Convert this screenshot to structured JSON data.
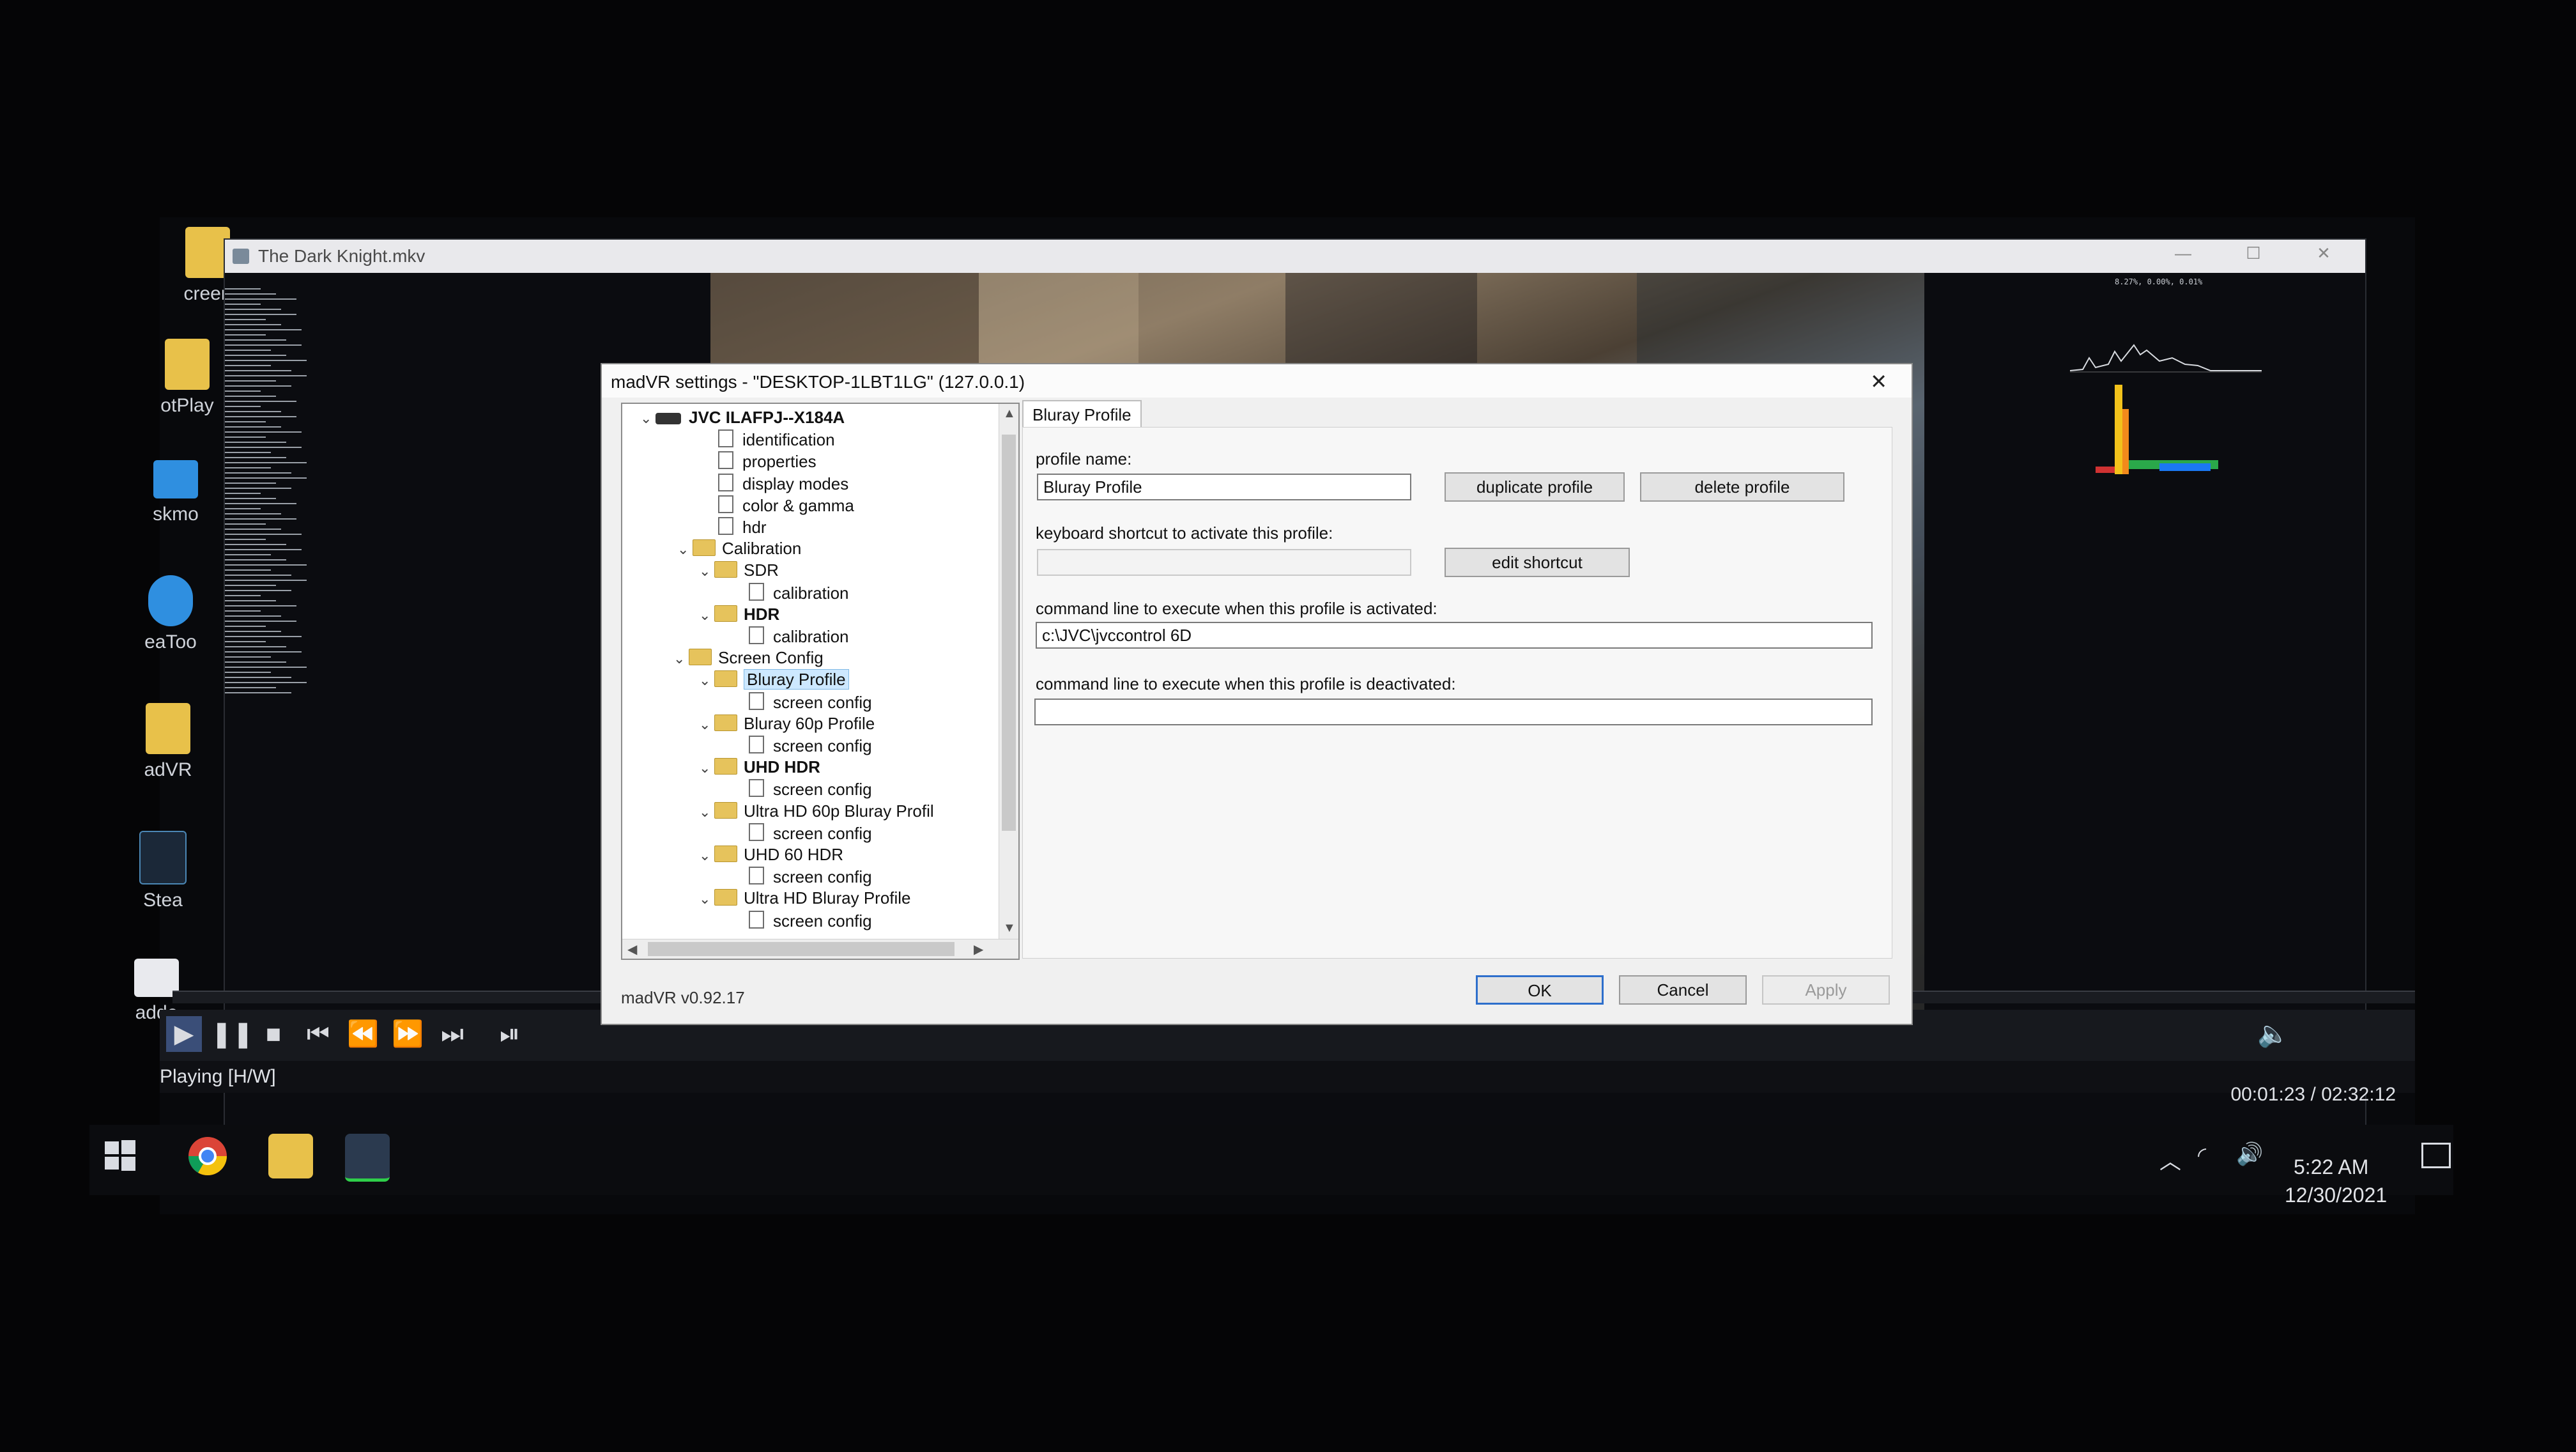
{
  "desktop": {
    "icons": [
      {
        "label": "creen"
      },
      {
        "label": "otPlay"
      },
      {
        "label": "skmo"
      },
      {
        "label": "eaToo"
      },
      {
        "label": "adVR"
      },
      {
        "label": "Stea"
      },
      {
        "label": "adde"
      }
    ]
  },
  "player": {
    "title": "The Dark Knight.mkv",
    "status": "Playing [H/W]",
    "time": "00:01:23 / 02:32:12",
    "controls": [
      "play-icon",
      "pause-icon",
      "stop-icon",
      "skip-back-icon",
      "rewind-icon",
      "fast-forward-icon",
      "skip-forward-icon",
      "frame-step-icon"
    ],
    "osd_top_right": "8.27%, 0.00%, 0.01%"
  },
  "dialog": {
    "title": "madVR settings - \"DESKTOP-1LBT1LG\" (127.0.0.1)",
    "close_label": "✕",
    "tree": [
      {
        "label": "JVC ILAFPJ--X184A",
        "type": "device",
        "bold": true
      },
      {
        "label": "identification",
        "type": "page"
      },
      {
        "label": "properties",
        "type": "page"
      },
      {
        "label": "display modes",
        "type": "page"
      },
      {
        "label": "color & gamma",
        "type": "page"
      },
      {
        "label": "hdr",
        "type": "page"
      },
      {
        "label": "Calibration",
        "type": "folder"
      },
      {
        "label": "SDR",
        "type": "folder"
      },
      {
        "label": "calibration",
        "type": "page"
      },
      {
        "label": "HDR",
        "type": "folder",
        "bold": true
      },
      {
        "label": "calibration",
        "type": "page"
      },
      {
        "label": "Screen Config",
        "type": "folder"
      },
      {
        "label": "Bluray Profile",
        "type": "folder",
        "selected": true
      },
      {
        "label": "screen config",
        "type": "page"
      },
      {
        "label": "Bluray 60p Profile",
        "type": "folder"
      },
      {
        "label": "screen config",
        "type": "page"
      },
      {
        "label": "UHD HDR",
        "type": "folder",
        "bold": true
      },
      {
        "label": "screen config",
        "type": "page"
      },
      {
        "label": "Ultra HD 60p Bluray Profil",
        "type": "folder"
      },
      {
        "label": "screen config",
        "type": "page"
      },
      {
        "label": "UHD 60 HDR",
        "type": "folder"
      },
      {
        "label": "screen config",
        "type": "page"
      },
      {
        "label": "Ultra HD Bluray Profile",
        "type": "folder"
      },
      {
        "label": "screen config",
        "type": "page"
      }
    ],
    "tab_label": "Bluray Profile",
    "profile_name_label": "profile name:",
    "profile_name_value": "Bluray Profile",
    "duplicate_label": "duplicate profile",
    "delete_label": "delete profile",
    "shortcut_label": "keyboard shortcut to activate this profile:",
    "shortcut_value": "",
    "edit_shortcut_label": "edit shortcut",
    "cmd_activate_label": "command line to execute when this profile is activated:",
    "cmd_activate_value": "c:\\JVC\\jvccontrol 6D",
    "cmd_deactivate_label": "command line to execute when this profile is deactivated:",
    "cmd_deactivate_value": "",
    "version": "madVR v0.92.17",
    "ok_label": "OK",
    "cancel_label": "Cancel",
    "apply_label": "Apply"
  },
  "taskbar": {
    "time": "5:22 AM",
    "date": "12/30/2021"
  },
  "colors": {
    "accent": "#2e6fcc",
    "selection": "#cde8ff",
    "folder": "#e6c35c",
    "seek_orange": "#e0561c"
  }
}
